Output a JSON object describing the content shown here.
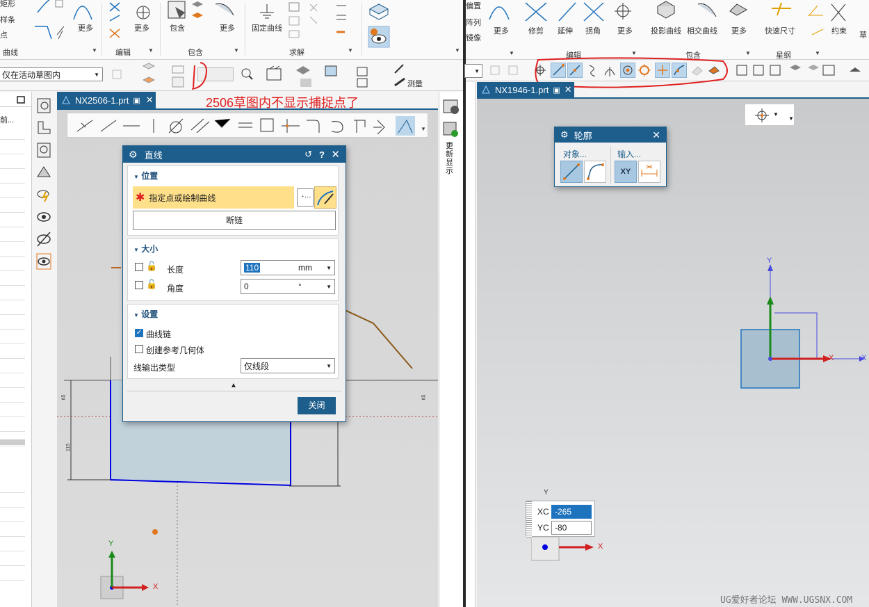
{
  "left_ribbon": {
    "curve_group_items": [
      "矩形",
      "样条",
      "点"
    ],
    "groups": {
      "curve": "曲线",
      "edit": "编辑",
      "include": "包含",
      "solve": "求解"
    },
    "more_1": "更多",
    "more_2": "更多",
    "more_3": "更多",
    "include_btn": "包含",
    "fixed_curve": "固定曲线"
  },
  "left_toolbar": {
    "filter_value": "仅在活动草图内",
    "measure": "测量"
  },
  "left_tab": {
    "title": "NX2506-1.prt"
  },
  "annotation": "2506草图内不显示捕捉点了",
  "side_panel_label": "更新显示",
  "left_nav_items": [
    "前..."
  ],
  "line_dialog": {
    "title": "直线",
    "position_section": "位置",
    "specify_point": "指定点或绘制曲线",
    "break_chain": "断链",
    "size_section": "大小",
    "length_label": "长度",
    "length_value": "110",
    "length_unit": "mm",
    "angle_label": "角度",
    "angle_value": "0",
    "angle_unit": "°",
    "settings_section": "设置",
    "curve_chain": "曲线链",
    "create_ref": "创建参考几何体",
    "output_label": "线输出类型",
    "output_value": "仅线段",
    "close": "关闭"
  },
  "left_canvas": {
    "dim_65_left": "65",
    "dim_65_right": "65",
    "dim_115": "115",
    "axis_y": "Y",
    "axis_x": "X"
  },
  "right_ribbon": {
    "top_items": [
      "偏置",
      "阵列",
      "镜像"
    ],
    "buttons": [
      "更多",
      "修剪",
      "延伸",
      "拐角",
      "更多",
      "投影曲线",
      "相交曲线",
      "更多",
      "快速尺寸",
      "约束",
      "草"
    ],
    "groups": {
      "edit": "编辑",
      "include": "包含",
      "geometry": "星纲"
    }
  },
  "right_tab": {
    "title": "NX1946-1.prt"
  },
  "profile_dialog": {
    "title": "轮廓",
    "object_label": "对象...",
    "input_label": "输入...",
    "xy_button": "XY"
  },
  "coord_input": {
    "xc_label": "XC",
    "xc_value": "-265",
    "yc_label": "YC",
    "yc_value": "-80"
  },
  "right_canvas": {
    "axis_y": "Y",
    "axis_x": "X",
    "axis_x2": "X",
    "coord_y": "Y",
    "coord_x": "X"
  },
  "watermark": "UG爱好者论坛 WWW.UGSNX.COM",
  "colors": {
    "nx_blue": "#1e5e8c",
    "highlight": "#ffe08a",
    "annotation_red": "#e02020",
    "sketch_blue": "#0000e0"
  }
}
